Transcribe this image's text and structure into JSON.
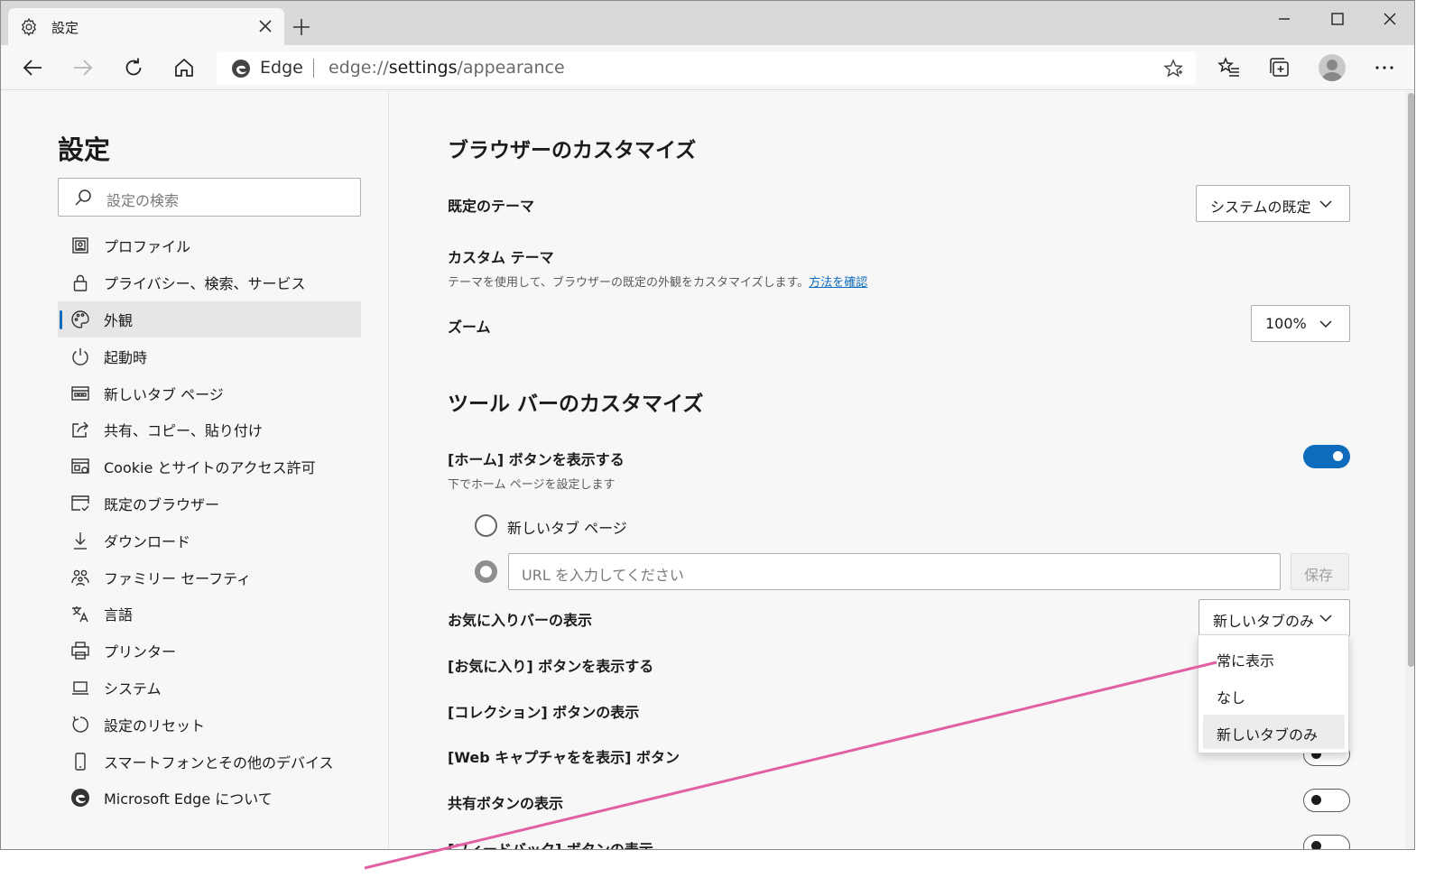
{
  "tab": {
    "title": "設定",
    "icon": "gear-icon"
  },
  "address": {
    "site": "Edge",
    "url_prefix": "edge://",
    "url_host": "settings",
    "url_path": "/appearance"
  },
  "sidebar": {
    "title": "設定",
    "search_placeholder": "設定の検索",
    "items": [
      {
        "label": "プロファイル",
        "icon": "profile-icon"
      },
      {
        "label": "プライバシー、検索、サービス",
        "icon": "lock-icon"
      },
      {
        "label": "外観",
        "icon": "palette-icon",
        "active": true
      },
      {
        "label": "起動時",
        "icon": "power-icon"
      },
      {
        "label": "新しいタブ ページ",
        "icon": "new-tab-page-icon"
      },
      {
        "label": "共有、コピー、貼り付け",
        "icon": "share-icon"
      },
      {
        "label": "Cookie とサイトのアクセス許可",
        "icon": "site-permissions-icon"
      },
      {
        "label": "既定のブラウザー",
        "icon": "default-browser-icon"
      },
      {
        "label": "ダウンロード",
        "icon": "download-icon"
      },
      {
        "label": "ファミリー セーフティ",
        "icon": "family-icon"
      },
      {
        "label": "言語",
        "icon": "language-icon"
      },
      {
        "label": "プリンター",
        "icon": "printer-icon"
      },
      {
        "label": "システム",
        "icon": "laptop-icon"
      },
      {
        "label": "設定のリセット",
        "icon": "reset-icon"
      },
      {
        "label": "スマートフォンとその他のデバイス",
        "icon": "phone-icon"
      },
      {
        "label": "Microsoft Edge について",
        "icon": "edge-logo-icon"
      }
    ]
  },
  "main": {
    "browser_customize_heading": "ブラウザーのカスタマイズ",
    "default_theme_label": "既定のテーマ",
    "default_theme_value": "システムの既定",
    "custom_theme_label": "カスタム テーマ",
    "custom_theme_desc": "テーマを使用して、ブラウザーの既定の外観をカスタマイズします。",
    "custom_theme_link": "方法を確認",
    "zoom_label": "ズーム",
    "zoom_value": "100%",
    "toolbar_customize_heading": "ツール バーのカスタマイズ",
    "home_button_label": "[ホーム] ボタンを表示する",
    "home_button_desc": "下でホーム ページを設定します",
    "home_button_on": true,
    "radio_new_tab_label": "新しいタブ ページ",
    "url_placeholder": "URL を入力してください",
    "save_label": "保存",
    "favorites_bar_label": "お気に入りバーの表示",
    "favorites_bar_value": "新しいタブのみ",
    "favorites_button_label": "[お気に入り] ボタンを表示する",
    "collections_button_label": "[コレクション] ボタンの表示",
    "web_capture_label": "[Web キャプチャをを表示] ボタン",
    "share_button_label": "共有ボタンの表示",
    "feedback_button_label": "[フィードバック] ボタンの表示"
  },
  "dropdown_menu": {
    "options": [
      "常に表示",
      "なし",
      "新しいタブのみ"
    ],
    "selected": "新しいタブのみ"
  },
  "colors": {
    "accent": "#0f6cbd",
    "annotation_line": "#e25fa3"
  }
}
